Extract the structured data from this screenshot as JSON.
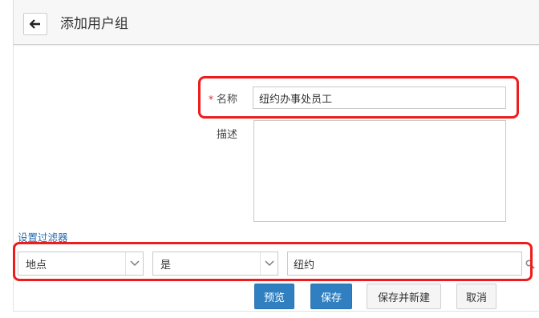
{
  "header": {
    "title": "添加用户组",
    "back_icon": "arrow-left-icon"
  },
  "form": {
    "name_label": "名称",
    "required_mark": "*",
    "name_value": "纽约办事处员工",
    "description_label": "描述",
    "description_value": ""
  },
  "filter": {
    "link_label": "设置过滤器",
    "field_value": "地点",
    "operator_value": "是",
    "value": "纽约"
  },
  "buttons": {
    "preview": "预览",
    "save": "保存",
    "save_and_new": "保存并新建",
    "cancel": "取消"
  },
  "colors": {
    "primary": "#2f7fc1",
    "highlight": "#ee1c1c",
    "link": "#2a6db0",
    "required": "#d9262b"
  }
}
